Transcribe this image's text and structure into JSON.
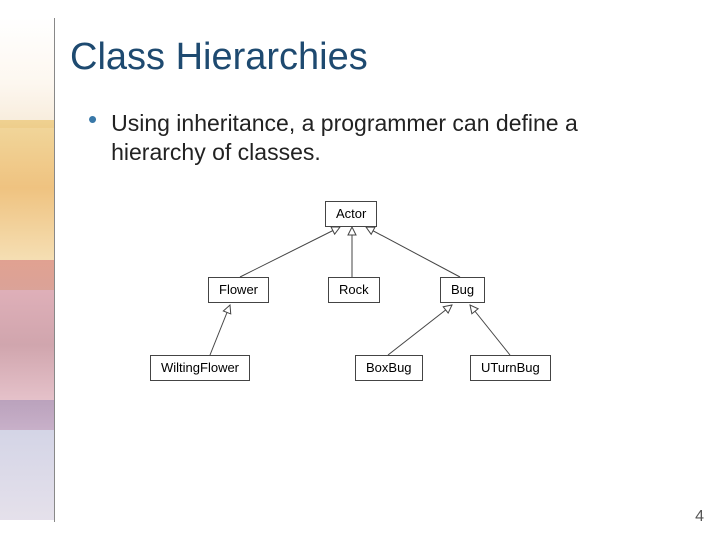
{
  "title": "Class Hierarchies",
  "bullet": "Using inheritance, a programmer can define a hierarchy of classes.",
  "page_number": "4",
  "diagram": {
    "actor": "Actor",
    "flower": "Flower",
    "rock": "Rock",
    "bug": "Bug",
    "wilting": "WiltingFlower",
    "boxbug": "BoxBug",
    "uturn": "UTurnBug"
  }
}
